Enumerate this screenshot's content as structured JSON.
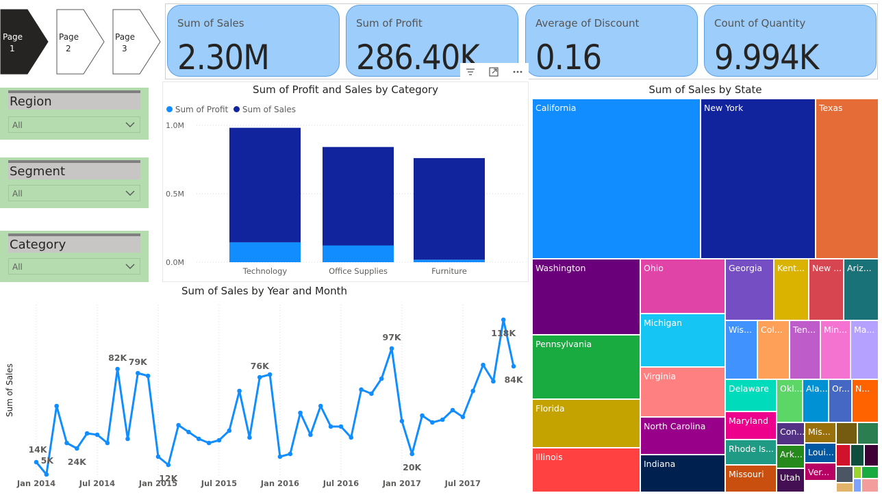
{
  "pages": [
    {
      "line1": "Page",
      "line2": "1",
      "active": true
    },
    {
      "line1": "Page",
      "line2": "2",
      "active": false
    },
    {
      "line1": "Page",
      "line2": "3",
      "active": false
    }
  ],
  "kpis": [
    {
      "title": "Sum of Sales",
      "value": "2.30M"
    },
    {
      "title": "Sum of Profit",
      "value": "286.40K"
    },
    {
      "title": "Average of Discount",
      "value": "0.16"
    },
    {
      "title": "Count of Quantity",
      "value": "9.994K"
    }
  ],
  "slicers": [
    {
      "title": "Region",
      "value": "All"
    },
    {
      "title": "Segment",
      "value": "All"
    },
    {
      "title": "Category",
      "value": "All"
    }
  ],
  "visual_header": {
    "filter_icon": "filter-icon",
    "focus_icon": "focus-mode-icon",
    "more_icon": "more-options-icon"
  },
  "category_chart": {
    "title": "Sum of Profit and Sales by Category",
    "legend": [
      "Sum of Profit",
      "Sum of Sales"
    ],
    "colors": {
      "profit": "#118dff",
      "sales": "#12239e"
    },
    "y_ticks": [
      "1.0M",
      "0.5M",
      "0.0M"
    ]
  },
  "month_chart": {
    "title": "Sum of Sales by Year and Month",
    "ylabel": "Sum of Sales",
    "x_ticks": [
      "Jan 2014",
      "Jul 2014",
      "Jan 2015",
      "Jul 2015",
      "Jan 2016",
      "Jul 2016",
      "Jan 2017",
      "Jul 2017"
    ],
    "color": "#118dff"
  },
  "treemap": {
    "title": "Sum of Sales by State",
    "labels": [
      "California",
      "New York",
      "Texas",
      "Washington",
      "Ohio",
      "Georgia",
      "Kent...",
      "New ...",
      "Ariz...",
      "Pennsylvania",
      "Michigan",
      "Wis...",
      "Col...",
      "Ten...",
      "Min...",
      "Ma...",
      "Florida",
      "Virginia",
      "Delaware",
      "Okl...",
      "Ala...",
      "Or...",
      "N...",
      "North Carolina",
      "Maryland",
      "Con...",
      "Mis...",
      "Illinois",
      "Rhode Is...",
      "Ark...",
      "Loui...",
      "Indiana",
      "Missouri",
      "Utah",
      "Ver..."
    ]
  },
  "chart_data": [
    {
      "type": "bar",
      "title": "Sum of Profit and Sales by Category",
      "categories": [
        "Technology",
        "Office Supplies",
        "Furniture"
      ],
      "series": [
        {
          "name": "Sum of Profit",
          "values": [
            145455,
            122491,
            18451
          ]
        },
        {
          "name": "Sum of Sales",
          "values": [
            836154,
            719047,
            741999
          ]
        }
      ],
      "stacked": true,
      "ylim": [
        0,
        1100000
      ],
      "y_ticks": [
        "0.0M",
        "0.5M",
        "1.0M"
      ],
      "legend": "top-left"
    },
    {
      "type": "line",
      "title": "Sum of Sales by Year and Month",
      "xlabel": "",
      "ylabel": "Sum of Sales",
      "x": [
        "Jan 2014",
        "Feb 2014",
        "Mar 2014",
        "Apr 2014",
        "May 2014",
        "Jun 2014",
        "Jul 2014",
        "Aug 2014",
        "Sep 2014",
        "Oct 2014",
        "Nov 2014",
        "Dec 2014",
        "Jan 2015",
        "Feb 2015",
        "Mar 2015",
        "Apr 2015",
        "May 2015",
        "Jun 2015",
        "Jul 2015",
        "Aug 2015",
        "Sep 2015",
        "Oct 2015",
        "Nov 2015",
        "Dec 2015",
        "Jan 2016",
        "Feb 2016",
        "Mar 2016",
        "Apr 2016",
        "May 2016",
        "Jun 2016",
        "Jul 2016",
        "Aug 2016",
        "Sep 2016",
        "Oct 2016",
        "Nov 2016",
        "Dec 2016",
        "Jan 2017",
        "Feb 2017",
        "Mar 2017",
        "Apr 2017",
        "May 2017",
        "Jun 2017",
        "Jul 2017",
        "Aug 2017",
        "Sep 2017",
        "Oct 2017",
        "Nov 2017",
        "Dec 2017"
      ],
      "values": [
        14000,
        5000,
        55000,
        28000,
        24000,
        35000,
        34000,
        28000,
        82000,
        31000,
        79000,
        77000,
        18000,
        12000,
        41000,
        36000,
        31000,
        28000,
        30000,
        37000,
        66000,
        32000,
        76000,
        78000,
        18000,
        20000,
        50000,
        34000,
        55000,
        40000,
        40000,
        32000,
        67000,
        64000,
        75000,
        97000,
        44000,
        20000,
        48000,
        43000,
        45000,
        52000,
        47000,
        66000,
        85000,
        73000,
        118000,
        84000
      ],
      "data_labels": [
        "14K",
        "5K",
        "24K",
        "82K",
        "79K",
        "12K",
        "76K",
        "97K",
        "20K",
        "118K",
        "84K"
      ],
      "x_ticks": [
        "Jan 2014",
        "Jul 2014",
        "Jan 2015",
        "Jul 2015",
        "Jan 2016",
        "Jul 2016",
        "Jan 2017",
        "Jul 2017"
      ],
      "grid": false
    },
    {
      "type": "treemap",
      "title": "Sum of Sales by State",
      "categories": [
        "California",
        "New York",
        "Texas",
        "Washington",
        "Ohio",
        "Georgia",
        "Kent...",
        "New ...",
        "Ariz...",
        "Pennsylvania",
        "Michigan",
        "Wis...",
        "Col...",
        "Ten...",
        "Min...",
        "Ma...",
        "Florida",
        "Virginia",
        "Delaware",
        "Okl...",
        "Ala...",
        "Or...",
        "N...",
        "North Carolina",
        "Maryland",
        "Con...",
        "Mis...",
        "Illinois",
        "Rhode Is...",
        "Ark...",
        "Loui...",
        "Indiana",
        "Missouri",
        "Utah",
        "Ver..."
      ],
      "colors": [
        "#118dff",
        "#12239e",
        "#e66c37",
        "#6b007b",
        "#e044a7",
        "#744ec2",
        "#d9b300",
        "#d64550",
        "#197278",
        "#1aab40",
        "#15c6f4",
        "#4092ff",
        "#ffa058",
        "#be5dc9",
        "#f472d0",
        "#b5a1ff",
        "#c4a200",
        "#ff8080",
        "#00dbbc",
        "#5bd667",
        "#0091d5",
        "#4668c5",
        "#ff6300",
        "#99008a",
        "#ec008c",
        "#533285",
        "#99700a",
        "#ff4141",
        "#1f9a85",
        "#25891c",
        "#0057a2",
        "#002050",
        "#c94f0f",
        "#450f54",
        "#b60064"
      ]
    }
  ]
}
